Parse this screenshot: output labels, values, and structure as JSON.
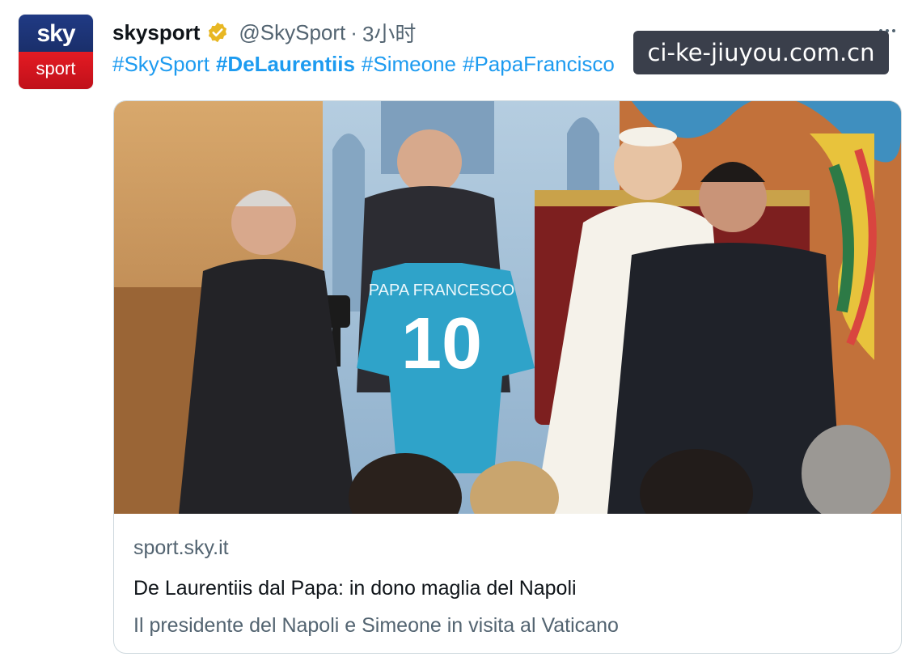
{
  "account": {
    "avatar_top": "sky",
    "avatar_bottom": "sport",
    "display_name": "skysport",
    "verified_icon": "verified-badge-icon",
    "handle": "@SkySport",
    "separator": "·",
    "time": "3小时"
  },
  "tweet": {
    "hashtags": [
      {
        "text": "#SkySport",
        "bold": false
      },
      {
        "text": "#DeLaurentiis",
        "bold": true
      },
      {
        "text": "#Simeone",
        "bold": false
      },
      {
        "text": "#PapaFrancisco",
        "bold": false
      }
    ]
  },
  "watermark": "ci-ke-jiuyou.com.cn",
  "card": {
    "jersey_name": "PAPA FRANCESCO",
    "jersey_number": "10",
    "domain": "sport.sky.it",
    "title": "De Laurentiis dal Papa: in dono maglia del Napoli",
    "description": "Il presidente del Napoli e Simeone in visita al Vaticano"
  },
  "colors": {
    "link": "#1d9bf0",
    "muted": "#536471",
    "jersey": "#2fa3c9",
    "sky_blue": "#203a84",
    "sky_red": "#e41b23"
  }
}
